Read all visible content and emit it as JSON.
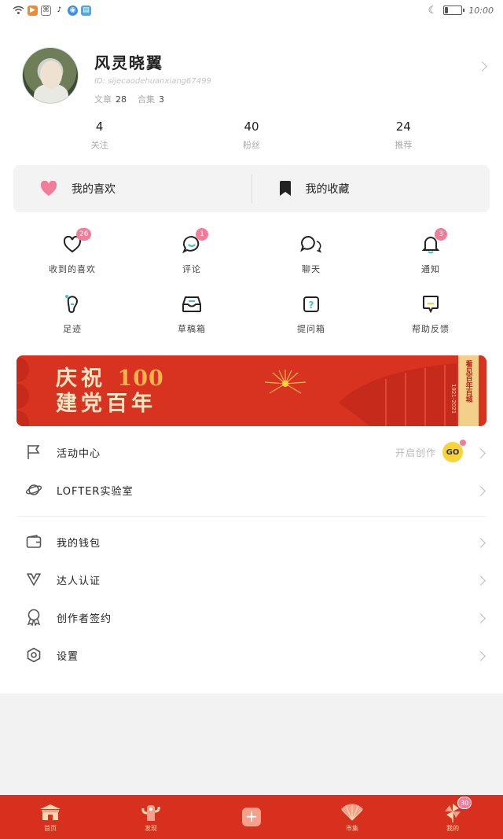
{
  "status_bar": {
    "time": "10:00",
    "battery_level": 0.2,
    "icons": [
      "wifi-icon",
      "video-app-icon",
      "game-app-icon",
      "tiktok-icon",
      "browser-icon",
      "note-app-icon",
      "moon-icon"
    ]
  },
  "profile": {
    "username": "风灵晓翼",
    "id_text": "ID: sijecaodehuanxiang67499",
    "articles_label": "文章",
    "articles_count": "28",
    "collections_label": "合集",
    "collections_count": "3"
  },
  "counts": [
    {
      "num": "4",
      "label": "关注"
    },
    {
      "num": "40",
      "label": "粉丝"
    },
    {
      "num": "24",
      "label": "推荐"
    }
  ],
  "like_bar": {
    "likes_label": "我的喜欢",
    "favorites_label": "我的收藏"
  },
  "grid": [
    {
      "label": "收到的喜欢",
      "badge": "26",
      "icon": "heart-outline-icon"
    },
    {
      "label": "评论",
      "badge": "1",
      "icon": "comment-bubble-icon"
    },
    {
      "label": "聊天",
      "badge": "",
      "icon": "chat-bubbles-icon"
    },
    {
      "label": "通知",
      "badge": "3",
      "icon": "bell-icon"
    },
    {
      "label": "足迹",
      "badge": "",
      "icon": "footprint-icon"
    },
    {
      "label": "草稿箱",
      "badge": "",
      "icon": "inbox-tray-icon"
    },
    {
      "label": "提问箱",
      "badge": "",
      "icon": "question-box-icon"
    },
    {
      "label": "帮助反馈",
      "badge": "",
      "icon": "feedback-icon"
    }
  ],
  "banner": {
    "line1_text": "庆祝",
    "line1_num": "100",
    "line2": "建党百年",
    "side_text": "看见百年百城",
    "years": "1921-2021"
  },
  "menu": {
    "activity": {
      "label": "活动中心",
      "hint": "开启创作",
      "go": "GO"
    },
    "lab": {
      "label": "LOFTER实验室"
    },
    "wallet": {
      "label": "我的钱包"
    },
    "verify": {
      "label": "达人认证"
    },
    "sign": {
      "label": "创作者签约"
    },
    "settings": {
      "label": "设置"
    }
  },
  "tabbar": [
    {
      "label": "首页",
      "icon": "home-gate-icon"
    },
    {
      "label": "发现",
      "icon": "discover-icon"
    },
    {
      "label": "",
      "icon": "plus-icon"
    },
    {
      "label": "市集",
      "icon": "fan-market-icon"
    },
    {
      "label": "我的",
      "icon": "pinwheel-icon",
      "badge": "30"
    }
  ],
  "colors": {
    "accent_pink": "#f27d9b",
    "festive_red": "#d7301f",
    "go_yellow": "#f7d33a"
  }
}
